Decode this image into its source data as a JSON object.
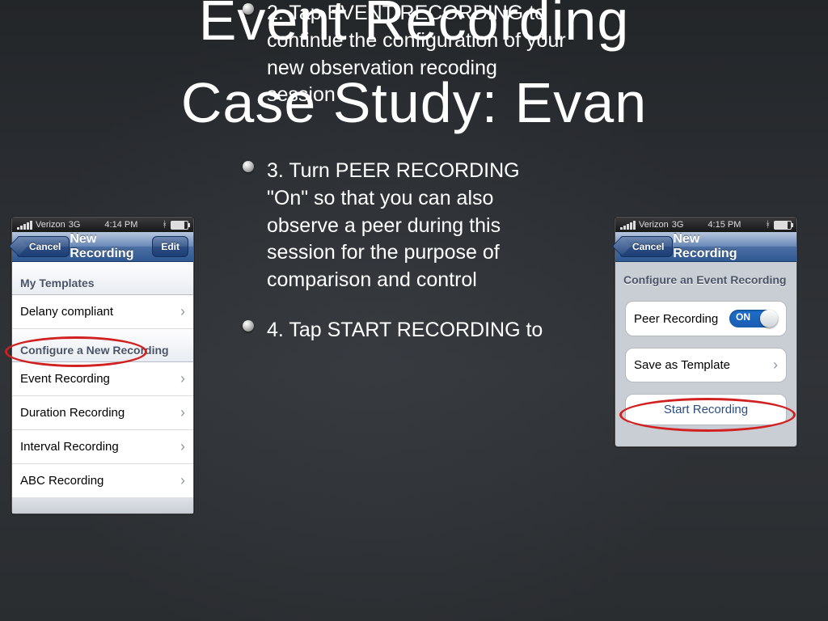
{
  "headings": {
    "title": "Event Recording",
    "subtitle": "Case Study: Evan"
  },
  "steps": {
    "s2": "2. Tap EVENT RECORDING to continue the configuration of your new observation recoding session",
    "s3": "3. Turn PEER RECORDING \"On\" so that you can also observe a peer during this session for the purpose of comparison and control",
    "s4": "4. Tap START RECORDING to"
  },
  "leftPhone": {
    "carrier": "Verizon",
    "time": "4:14 PM",
    "nav": {
      "cancel": "Cancel",
      "title": "New Recording",
      "edit": "Edit"
    },
    "section1": "My Templates",
    "rows1": [
      "Delany compliant"
    ],
    "section2": "Configure a New Recording",
    "rows2": [
      "Event Recording",
      "Duration Recording",
      "Interval Recording",
      "ABC Recording"
    ]
  },
  "rightPhone": {
    "carrier": "Verizon",
    "time": "4:15 PM",
    "nav": {
      "cancel": "Cancel",
      "title": "New Recording"
    },
    "section1": "Configure an Event Recording",
    "peerLabel": "Peer Recording",
    "switchLabel": "ON",
    "saveTemplate": "Save as Template",
    "startRecording": "Start Recording"
  }
}
